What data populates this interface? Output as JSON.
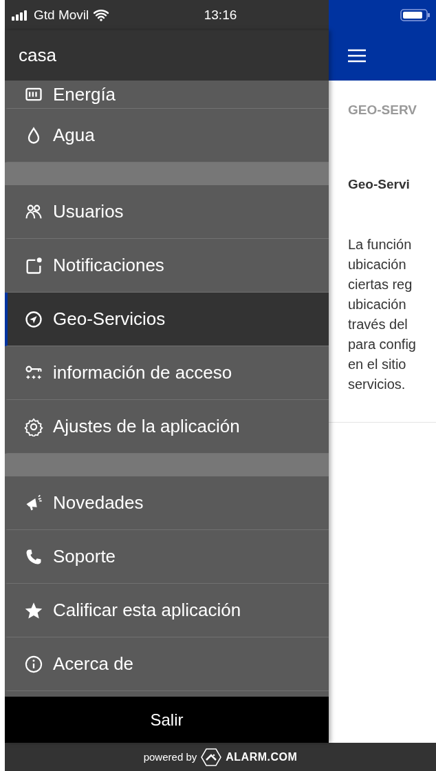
{
  "status_bar": {
    "carrier": "Gtd Movil",
    "time": "13:16"
  },
  "drawer": {
    "title": "casa",
    "sections": [
      [
        {
          "label": "Energía",
          "selected": false
        },
        {
          "label": "Agua",
          "selected": false
        }
      ],
      [
        {
          "label": "Usuarios",
          "selected": false
        },
        {
          "label": "Notificaciones",
          "selected": false
        },
        {
          "label": "Geo-Servicios",
          "selected": true
        },
        {
          "label": "información de acceso",
          "selected": false
        },
        {
          "label": "Ajustes de la aplicación",
          "selected": false
        }
      ],
      [
        {
          "label": "Novedades",
          "selected": false
        },
        {
          "label": "Soporte",
          "selected": false
        },
        {
          "label": "Calificar esta aplicación",
          "selected": false
        },
        {
          "label": "Acerca de",
          "selected": false
        }
      ]
    ],
    "logout": "Salir"
  },
  "content": {
    "section_title": "GEO-SERV",
    "heading": "Geo-Servi",
    "paragraph_lines": [
      "La función",
      "ubicación",
      "ciertas reg",
      "ubicación",
      "través del",
      "para config",
      "en el sitio",
      "servicios."
    ]
  },
  "footer": {
    "powered_by": "powered by",
    "brand": "ALARM.COM"
  }
}
